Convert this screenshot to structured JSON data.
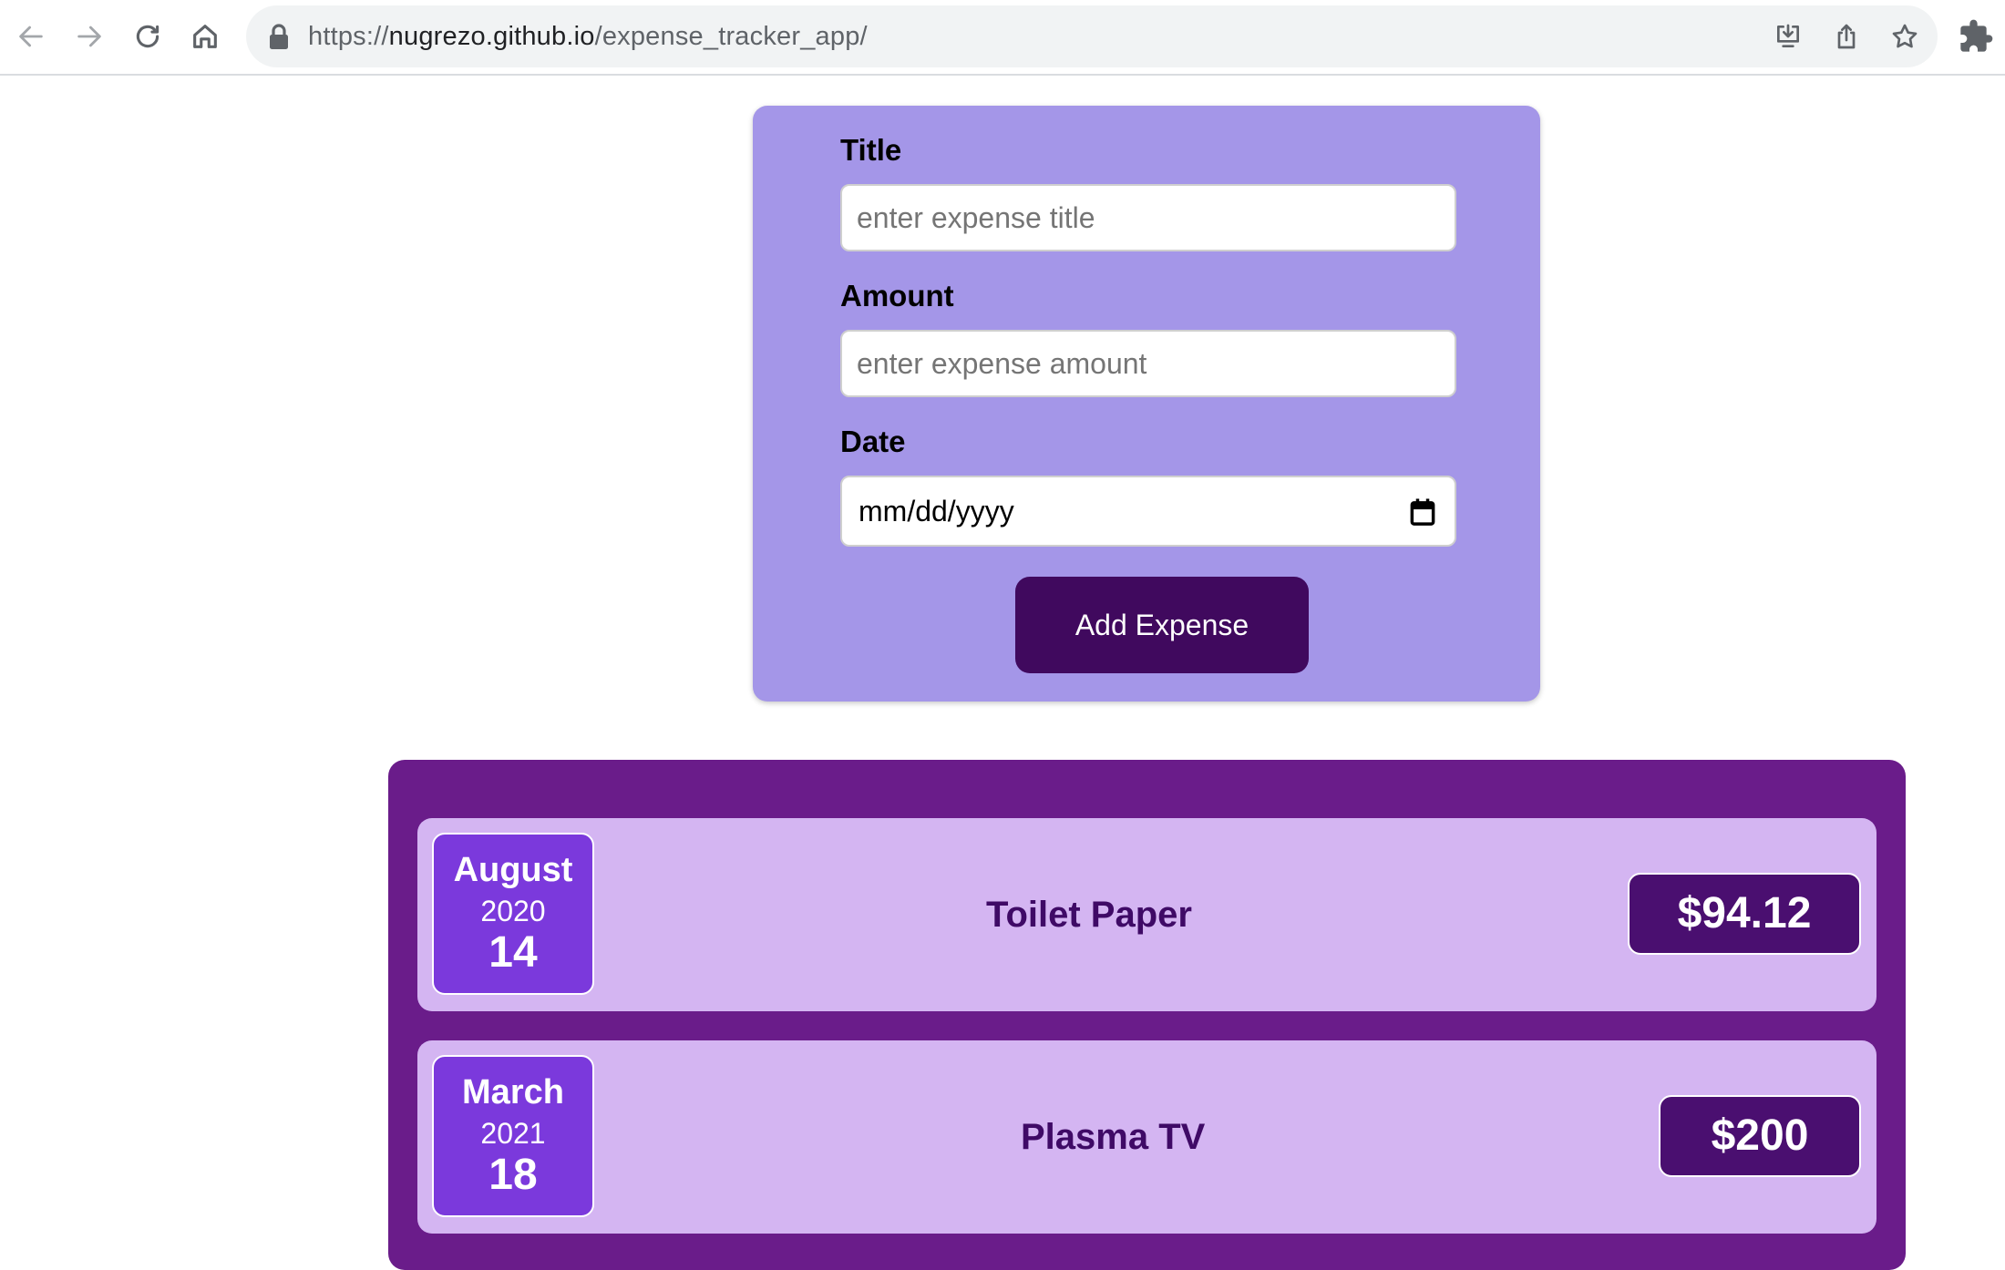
{
  "browser": {
    "url_scheme": "https://",
    "url_host": "nugrezo.github.io",
    "url_path": "/expense_tracker_app/"
  },
  "form": {
    "title_label": "Title",
    "title_placeholder": "enter expense title",
    "amount_label": "Amount",
    "amount_placeholder": "enter expense amount",
    "date_label": "Date",
    "date_placeholder": "mm/dd/yyyy",
    "submit_label": "Add Expense"
  },
  "expenses": [
    {
      "month": "August",
      "year": "2020",
      "day": "14",
      "title": "Toilet Paper",
      "amount": "$94.12"
    },
    {
      "month": "March",
      "year": "2021",
      "day": "18",
      "title": "Plasma TV",
      "amount": "$200"
    }
  ]
}
